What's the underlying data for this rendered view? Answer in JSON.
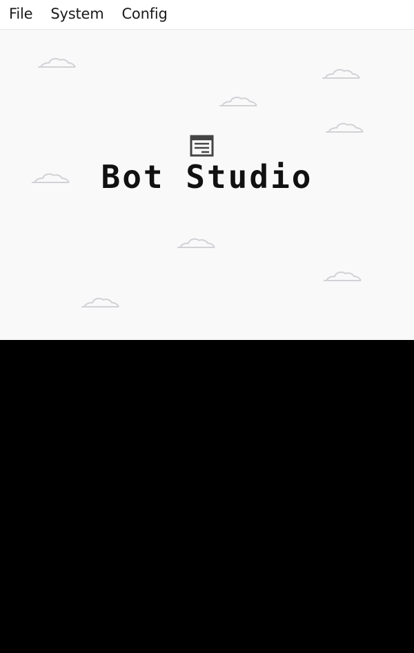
{
  "menubar": {
    "items": [
      {
        "label": "File"
      },
      {
        "label": "System"
      },
      {
        "label": "Config"
      }
    ]
  },
  "top_screen": {
    "background": "#f9f9fa",
    "icon": "bot-logo-icon",
    "title": "Bot Studio",
    "decorations": "cloud-icon"
  },
  "bottom_screen": {
    "background": "#000000"
  }
}
